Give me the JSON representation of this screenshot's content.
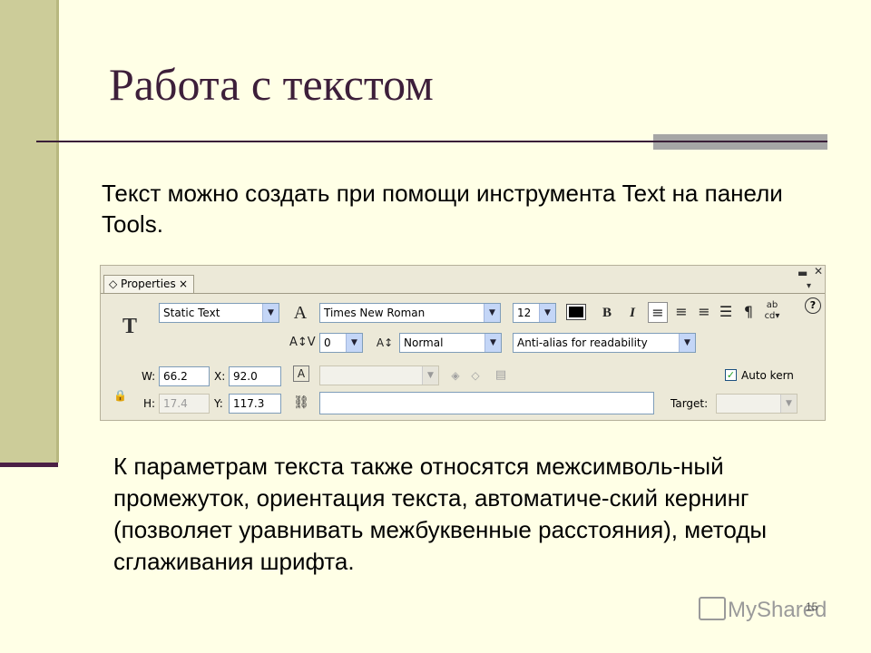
{
  "slide": {
    "title": "Работа с текстом",
    "paragraph1": "Текст можно создать при помощи инструмента Text на панели Tools.",
    "paragraph2": "К параметрам текста также относятся межсимволь-ный промежуток, ориентация текста, автоматиче-ский кернинг (позволяет уравнивать межбуквенные расстояния), методы сглаживания шрифта.",
    "page_number": "15",
    "watermark": "MyShared"
  },
  "panel": {
    "tab_label": "Properties",
    "tab_close": "×",
    "tool_icon": "T",
    "text_type": "Static Text",
    "font_family": "Times New Roman",
    "font_size": "12",
    "letter_spacing": "0",
    "baseline": "Normal",
    "anti_alias": "Anti-alias for readability",
    "width_label": "W:",
    "width_value": "66.2",
    "x_label": "X:",
    "x_value": "92.0",
    "height_label": "H:",
    "height_value": "17.4",
    "y_label": "Y:",
    "y_value": "117.3",
    "bold": "B",
    "italic": "I",
    "paragraph_symbol": "¶",
    "auto_kern_label": "Auto kern",
    "auto_kern_checked": true,
    "target_label": "Target:",
    "help": "?",
    "text_color": "#000000"
  },
  "icons": [
    "properties-tab-icon",
    "text-tool-icon",
    "font-icon",
    "letter-spacing-icon",
    "baseline-shift-icon",
    "align-left-icon",
    "align-center-icon",
    "align-right-icon",
    "justify-icon",
    "paragraph-icon",
    "format-options-icon",
    "link-icon",
    "selectable-icon",
    "html-render-icon",
    "border-icon",
    "lock-icon",
    "help-icon"
  ],
  "colors": {
    "background": "#ffffe6",
    "left_band": "#cccc99",
    "title": "#3d1f3a",
    "panel": "#ece9d8"
  }
}
